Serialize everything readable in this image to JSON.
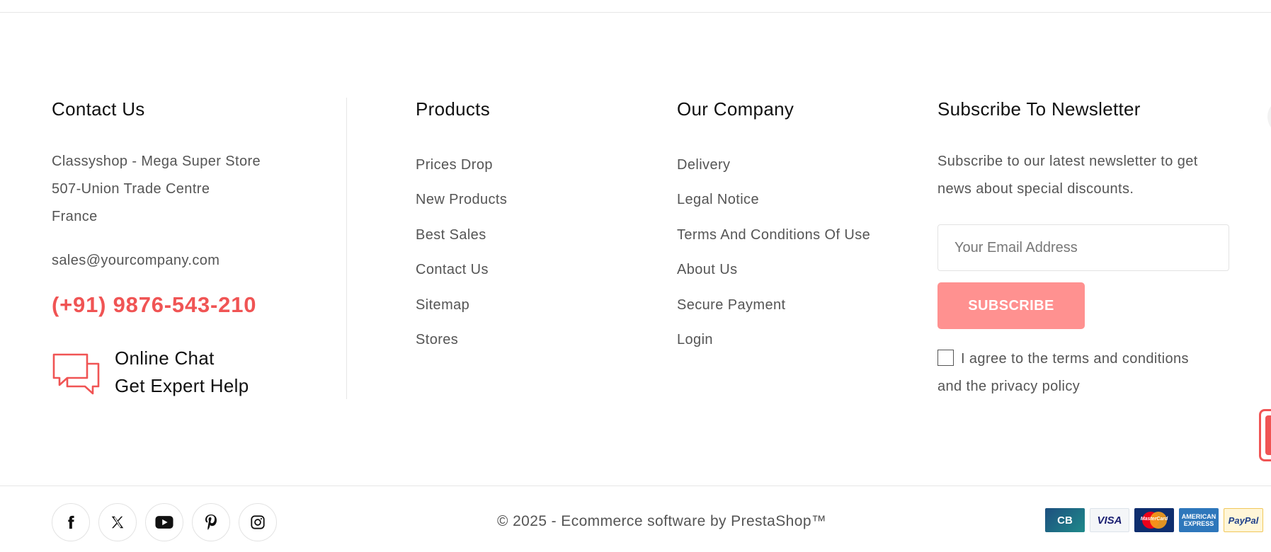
{
  "contact": {
    "title": "Contact Us",
    "address_lines": [
      "Classyshop - Mega Super Store",
      "507-Union Trade Centre",
      "France"
    ],
    "email": "sales@yourcompany.com",
    "phone": "(+91) 9876-543-210",
    "chat_line1": "Online Chat",
    "chat_line2": "Get Expert Help",
    "chat_icon": "chat-bubbles-icon",
    "accent_color": "#f05454"
  },
  "products": {
    "title": "Products",
    "links": [
      "Prices Drop",
      "New Products",
      "Best Sales",
      "Contact Us",
      "Sitemap",
      "Stores"
    ]
  },
  "company": {
    "title": "Our Company",
    "links": [
      "Delivery",
      "Legal Notice",
      "Terms And Conditions Of Use",
      "About Us",
      "Secure Payment",
      "Login"
    ]
  },
  "newsletter": {
    "title": "Subscribe To Newsletter",
    "text_lines": [
      "Subscribe to our latest newsletter to get",
      "news about special discounts."
    ],
    "email_placeholder": "Your Email Address",
    "email_value": "",
    "button_label": "SUBSCRIBE",
    "button_color": "#ff9190",
    "agree_lines": [
      "I agree to the terms and conditions",
      "and the privacy policy"
    ]
  },
  "footer": {
    "social_icons": [
      "facebook-icon",
      "x-twitter-icon",
      "youtube-icon",
      "pinterest-icon",
      "instagram-icon"
    ],
    "copyright": "© 2025 - Ecommerce software by PrestaShop™",
    "payment_icons": [
      "cb-card-icon",
      "visa-card-icon",
      "mastercard-icon",
      "american-express-icon",
      "paypal-icon"
    ],
    "payment_texts": {
      "cb": "CB",
      "visa": "VISA",
      "mastercard": "MasterCard",
      "amex_1": "AMERICAN",
      "amex_2": "EXPRESS",
      "paypal": "PayPal"
    }
  }
}
